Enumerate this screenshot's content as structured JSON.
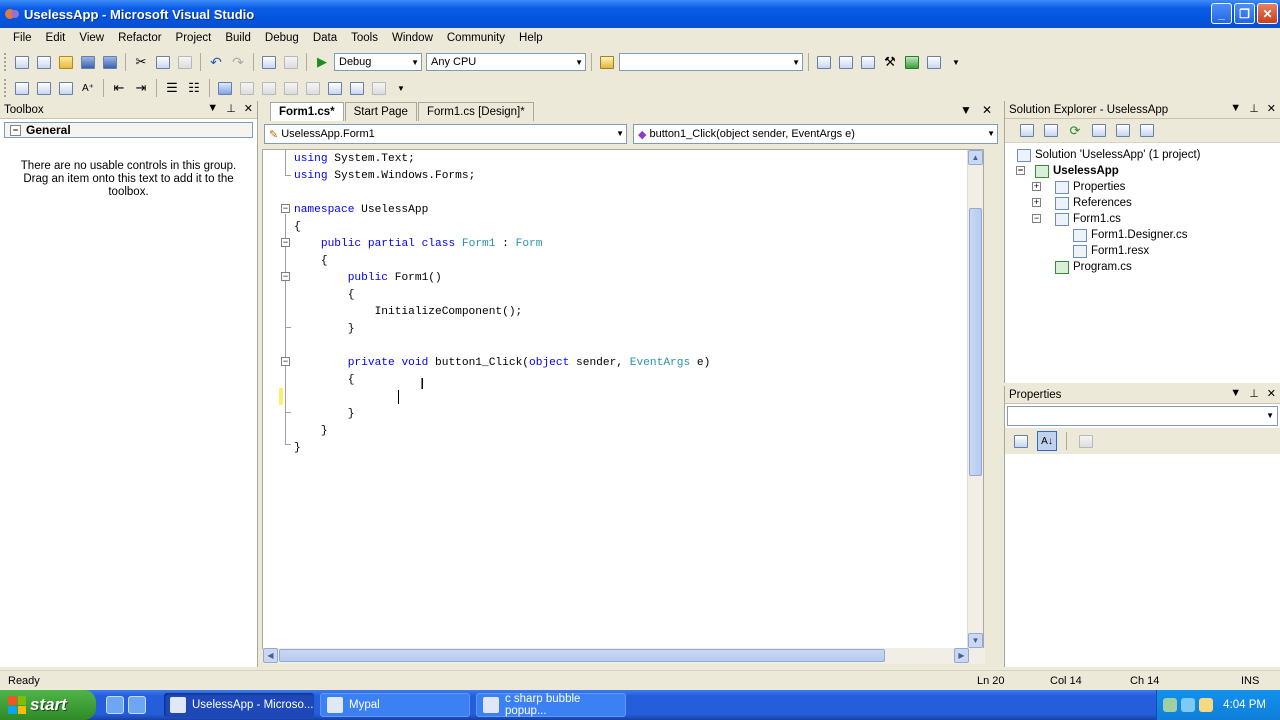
{
  "window": {
    "title": "UselessApp - Microsoft Visual Studio"
  },
  "menu": [
    "File",
    "Edit",
    "View",
    "Refactor",
    "Project",
    "Build",
    "Debug",
    "Data",
    "Tools",
    "Window",
    "Community",
    "Help"
  ],
  "toolbar": {
    "config": "Debug",
    "platform": "Any CPU",
    "find_value": ""
  },
  "toolbox": {
    "title": "Toolbox",
    "group": "General",
    "message": "There are no usable controls in this group. Drag an item onto this text to add it to the toolbox."
  },
  "editor": {
    "tabs": [
      {
        "label": "Form1.cs*",
        "active": true
      },
      {
        "label": "Start Page",
        "active": false
      },
      {
        "label": "Form1.cs [Design]*",
        "active": false
      }
    ],
    "type_dropdown": "UselessApp.Form1",
    "member_dropdown": "button1_Click(object sender, EventArgs e)",
    "code_lines": [
      "using System.Text;",
      "using System.Windows.Forms;",
      "",
      "namespace UselessApp",
      "{",
      "    public partial class Form1 : Form",
      "    {",
      "        public Form1()",
      "        {",
      "            InitializeComponent();",
      "        }",
      "",
      "        private void button1_Click(object sender, EventArgs e)",
      "        {",
      "",
      "        }",
      "    }",
      "}"
    ]
  },
  "solution_explorer": {
    "title": "Solution Explorer - UselessApp",
    "items": [
      {
        "label": "Solution 'UselessApp' (1 project)",
        "level": 0
      },
      {
        "label": "UselessApp",
        "level": 1
      },
      {
        "label": "Properties",
        "level": 2
      },
      {
        "label": "References",
        "level": 2
      },
      {
        "label": "Form1.cs",
        "level": 2
      },
      {
        "label": "Form1.Designer.cs",
        "level": 3
      },
      {
        "label": "Form1.resx",
        "level": 3
      },
      {
        "label": "Program.cs",
        "level": 2
      }
    ]
  },
  "properties": {
    "title": "Properties"
  },
  "status": {
    "ready": "Ready",
    "ln": "Ln 20",
    "col": "Col 14",
    "ch": "Ch 14",
    "mode": "INS"
  },
  "taskbar": {
    "start": "start",
    "tasks": [
      "UselessApp - Microso...",
      "Mypal",
      "c sharp bubble popup..."
    ],
    "clock": "4:04 PM"
  },
  "colors": {
    "keyword": "#0000ff",
    "type": "#2b91af",
    "titlebar": "#0a5ce6"
  }
}
